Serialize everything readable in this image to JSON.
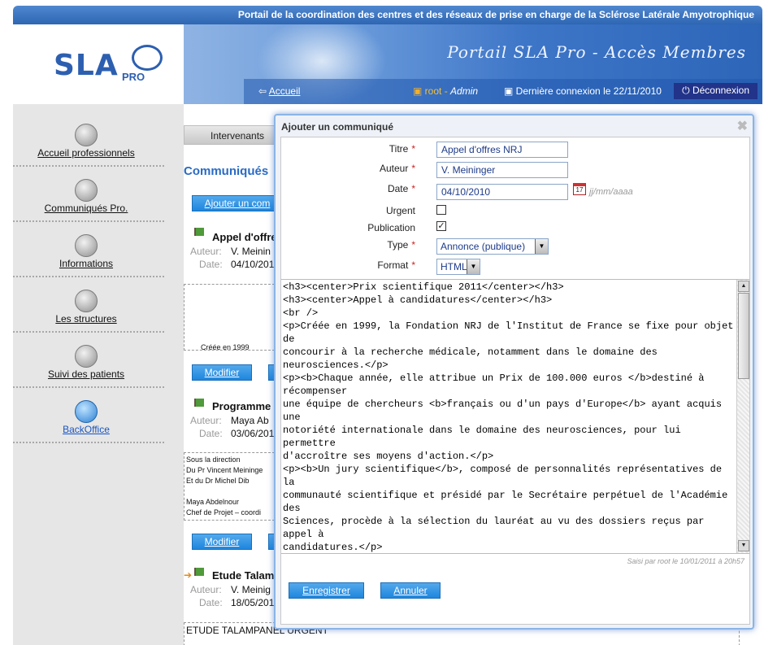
{
  "header": {
    "portal_text": "Portail de la coordination des centres et des réseaux de prise en charge de la Sclérose Latérale Amyotrophique",
    "logo_text": "SLA",
    "logo_sub": "PRO",
    "banner_title": "Portail SLA Pro - Accès Membres",
    "home_link": "Accueil",
    "user_name": "root",
    "user_role": "Admin",
    "last_login": "Dernière connexion le 22/11/2010",
    "logout_label": "Déconnexion"
  },
  "sidebar": {
    "items": [
      {
        "label": "Accueil professionnels",
        "icon": "bell-icon"
      },
      {
        "label": "Communiqués Pro.",
        "icon": "news-icon"
      },
      {
        "label": "Informations",
        "icon": "document-icon"
      },
      {
        "label": "Les structures",
        "icon": "structures-icon"
      },
      {
        "label": "Suivi des patients",
        "icon": "patient-icon"
      },
      {
        "label": "BackOffice",
        "icon": "backoffice-icon"
      }
    ]
  },
  "main": {
    "tab_label": "Intervenants",
    "section_title": "Communiqués",
    "add_button": "Ajouter un com",
    "entries": [
      {
        "title": "Appel d'offre",
        "author_label": "Auteur:",
        "author": "V. Meinin",
        "date_label": "Date:",
        "date": "04/10/201",
        "preview": "Créée en 1999",
        "edit_label": "Modifier"
      },
      {
        "title": "Programme",
        "author_label": "Auteur:",
        "author": "Maya Ab",
        "date_label": "Date:",
        "date": "03/06/201",
        "preview_lines": [
          "Sous la direction",
          "Du Pr Vincent Meininge",
          "Et du Dr Michel Dib",
          "",
          "Maya Abdelnour",
          "Chef de Projet – coordi"
        ],
        "edit_label": "Modifier"
      },
      {
        "title": "Etude Talam",
        "author_label": "Auteur:",
        "author": "V. Meinig",
        "date_label": "Date:",
        "date": "18/05/201",
        "preview": "ETUDE TALAMPANEL URGENT"
      }
    ]
  },
  "modal": {
    "title": "Ajouter un communiqué",
    "close": "✖",
    "fields": {
      "titre_label": "Titre",
      "titre_value": "Appel d'offres NRJ",
      "auteur_label": "Auteur",
      "auteur_value": "V. Meininger",
      "date_label": "Date",
      "date_value": "04/10/2010",
      "date_hint": "jj/mm/aaaa",
      "urgent_label": "Urgent",
      "urgent_checked": false,
      "publication_label": "Publication",
      "publication_checked": true,
      "type_label": "Type",
      "type_value": "Annonce (publique)",
      "format_label": "Format",
      "format_value": "HTML"
    },
    "editor_content": "<h3><center>Prix scientifique 2011</center></h3>\n<h3><center>Appel à candidatures</center></h3>\n<br />\n<p>Créée en 1999, la Fondation NRJ de l'Institut de France se fixe pour objet de\nconcourir à la recherche médicale, notamment dans le domaine des neurosciences.</p>\n<p><b>Chaque année, elle attribue un Prix de 100.000 euros </b>destiné à récompenser\nune équipe de chercheurs <b>français ou d'un pays d'Europe</b> ayant acquis une\nnotoriété internationale dans le domaine des neurosciences, pour lui permettre\nd'accroître ses moyens d'action.</p>\n<p><b>Un jury scientifique</b>, composé de personnalités représentatives de la\ncommunauté scientifique et présidé par le Secrétaire perpétuel de l'Académie des\nSciences, procède à la sélection du lauréat au vu des dossiers reçus par appel à\ncandidatures.</p>",
    "saved_by": "Saisi par root le 10/01/2011 à 20h57",
    "save_button": "Enregistrer",
    "cancel_button": "Annuler"
  }
}
